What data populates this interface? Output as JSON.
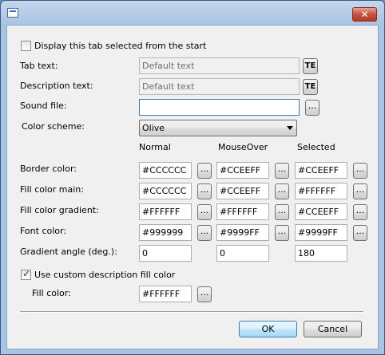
{
  "window": {
    "title": "",
    "close_label": "✕"
  },
  "display_tab": {
    "label": "Display this tab selected from the start",
    "checked": false
  },
  "tab_text": {
    "label": "Tab text:",
    "placeholder": "Default text",
    "te": "TE"
  },
  "description_text": {
    "label": "Description text:",
    "placeholder": "Default text",
    "te": "TE"
  },
  "sound_file": {
    "label": "Sound file:",
    "value": "",
    "browse": "..."
  },
  "color_scheme": {
    "label": "Color scheme:",
    "value": "Olive"
  },
  "columns": {
    "normal": "Normal",
    "mouseover": "MouseOver",
    "selected": "Selected"
  },
  "rows": {
    "border": {
      "label": "Border color:",
      "normal": "#CCCCCC",
      "mouseover": "#CCEEFF",
      "selected": "#CCEEFF"
    },
    "fill_main": {
      "label": "Fill color main:",
      "normal": "#CCCCCC",
      "mouseover": "#CCEEFF",
      "selected": "#FFFFFF"
    },
    "fill_gradient": {
      "label": "Fill color gradient:",
      "normal": "#FFFFFF",
      "mouseover": "#FFFFFF",
      "selected": "#CCEEFF"
    },
    "font": {
      "label": "Font color:",
      "normal": "#999999",
      "mouseover": "#9999FF",
      "selected": "#9999FF"
    },
    "gradient_angle": {
      "label": "Gradient angle (deg.):",
      "normal": "0",
      "mouseover": "0",
      "selected": "180"
    }
  },
  "ellipsis": "...",
  "custom_desc": {
    "label": "Use custom description fill color",
    "checked": true
  },
  "custom_fill": {
    "label": "Fill color:",
    "value": "#FFFFFF"
  },
  "buttons": {
    "ok": "OK",
    "cancel": "Cancel"
  }
}
